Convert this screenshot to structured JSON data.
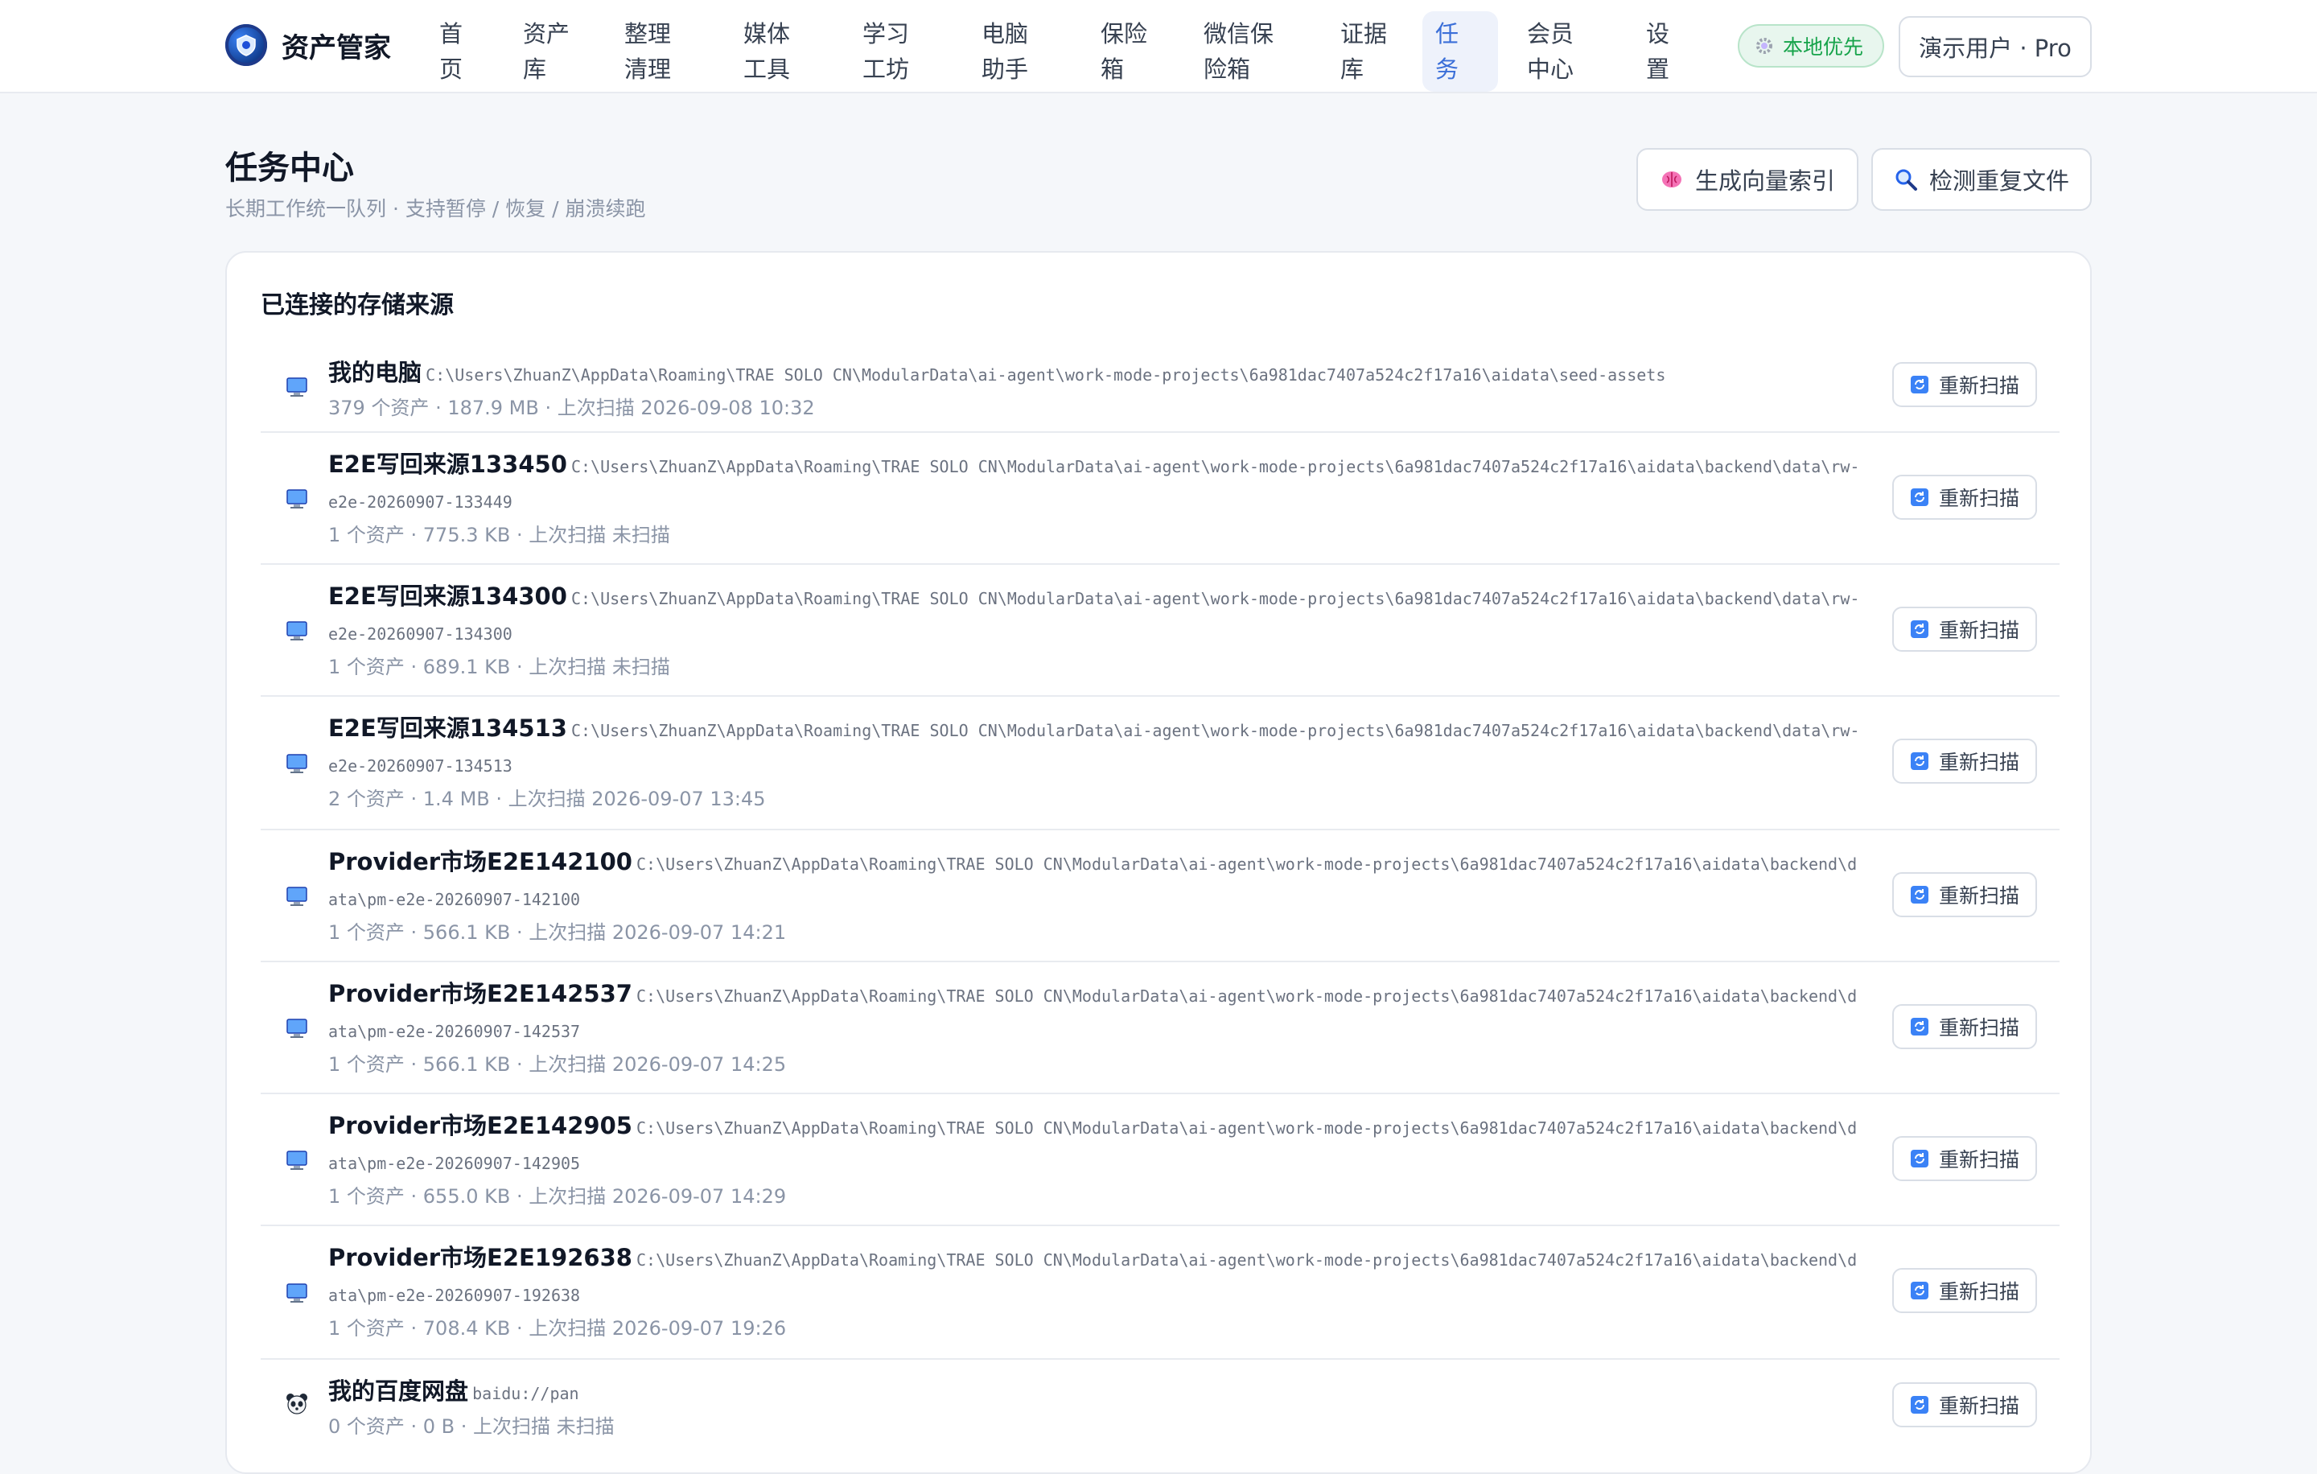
{
  "app": {
    "name": "资产管家"
  },
  "nav": [
    {
      "label": "首页"
    },
    {
      "label": "资产库"
    },
    {
      "label": "整理清理"
    },
    {
      "label": "媒体工具"
    },
    {
      "label": "学习工坊"
    },
    {
      "label": "电脑助手"
    },
    {
      "label": "保险箱"
    },
    {
      "label": "微信保险箱"
    },
    {
      "label": "证据库"
    },
    {
      "label": "任务",
      "active": true
    },
    {
      "label": "会员中心"
    },
    {
      "label": "设置"
    }
  ],
  "header": {
    "local_badge": "本地优先",
    "user": "演示用户 · Pro"
  },
  "page": {
    "title": "任务中心",
    "subtitle": "长期工作统一队列 · 支持暂停 / 恢复 / 崩溃续跑",
    "actions": {
      "vector_index": "生成向量索引",
      "dedupe": "检测重复文件"
    }
  },
  "sources": {
    "title": "已连接的存储来源",
    "rescan_label": "重新扫描",
    "items": [
      {
        "name": "我的电脑",
        "icon": "computer-icon",
        "path": "C:\\Users\\ZhuanZ\\AppData\\Roaming\\TRAE SOLO CN\\ModularData\\ai-agent\\work-mode-projects\\6a981dac7407a524c2f17a16\\aidata\\seed-assets",
        "meta": "379 个资产 · 187.9 MB · 上次扫描 2026-09-08 10:32"
      },
      {
        "name": "E2E写回来源133450",
        "icon": "computer-icon",
        "path": "C:\\Users\\ZhuanZ\\AppData\\Roaming\\TRAE SOLO CN\\ModularData\\ai-agent\\work-mode-projects\\6a981dac7407a524c2f17a16\\aidata\\backend\\data\\rw-e2e-20260907-133449",
        "meta": "1 个资产 · 775.3 KB · 上次扫描 未扫描"
      },
      {
        "name": "E2E写回来源134300",
        "icon": "computer-icon",
        "path": "C:\\Users\\ZhuanZ\\AppData\\Roaming\\TRAE SOLO CN\\ModularData\\ai-agent\\work-mode-projects\\6a981dac7407a524c2f17a16\\aidata\\backend\\data\\rw-e2e-20260907-134300",
        "meta": "1 个资产 · 689.1 KB · 上次扫描 未扫描"
      },
      {
        "name": "E2E写回来源134513",
        "icon": "computer-icon",
        "path": "C:\\Users\\ZhuanZ\\AppData\\Roaming\\TRAE SOLO CN\\ModularData\\ai-agent\\work-mode-projects\\6a981dac7407a524c2f17a16\\aidata\\backend\\data\\rw-e2e-20260907-134513",
        "meta": "2 个资产 · 1.4 MB · 上次扫描 2026-09-07 13:45"
      },
      {
        "name": "Provider市场E2E142100",
        "icon": "computer-icon",
        "path": "C:\\Users\\ZhuanZ\\AppData\\Roaming\\TRAE SOLO CN\\ModularData\\ai-agent\\work-mode-projects\\6a981dac7407a524c2f17a16\\aidata\\backend\\data\\pm-e2e-20260907-142100",
        "meta": "1 个资产 · 566.1 KB · 上次扫描 2026-09-07 14:21"
      },
      {
        "name": "Provider市场E2E142537",
        "icon": "computer-icon",
        "path": "C:\\Users\\ZhuanZ\\AppData\\Roaming\\TRAE SOLO CN\\ModularData\\ai-agent\\work-mode-projects\\6a981dac7407a524c2f17a16\\aidata\\backend\\data\\pm-e2e-20260907-142537",
        "meta": "1 个资产 · 566.1 KB · 上次扫描 2026-09-07 14:25"
      },
      {
        "name": "Provider市场E2E142905",
        "icon": "computer-icon",
        "path": "C:\\Users\\ZhuanZ\\AppData\\Roaming\\TRAE SOLO CN\\ModularData\\ai-agent\\work-mode-projects\\6a981dac7407a524c2f17a16\\aidata\\backend\\data\\pm-e2e-20260907-142905",
        "meta": "1 个资产 · 655.0 KB · 上次扫描 2026-09-07 14:29"
      },
      {
        "name": "Provider市场E2E192638",
        "icon": "computer-icon",
        "path": "C:\\Users\\ZhuanZ\\AppData\\Roaming\\TRAE SOLO CN\\ModularData\\ai-agent\\work-mode-projects\\6a981dac7407a524c2f17a16\\aidata\\backend\\data\\pm-e2e-20260907-192638",
        "meta": "1 个资产 · 708.4 KB · 上次扫描 2026-09-07 19:26"
      },
      {
        "name": "我的百度网盘",
        "icon": "panda-icon",
        "path": "baidu://pan",
        "meta": "0 个资产 · 0 B · 上次扫描 未扫描"
      }
    ]
  }
}
